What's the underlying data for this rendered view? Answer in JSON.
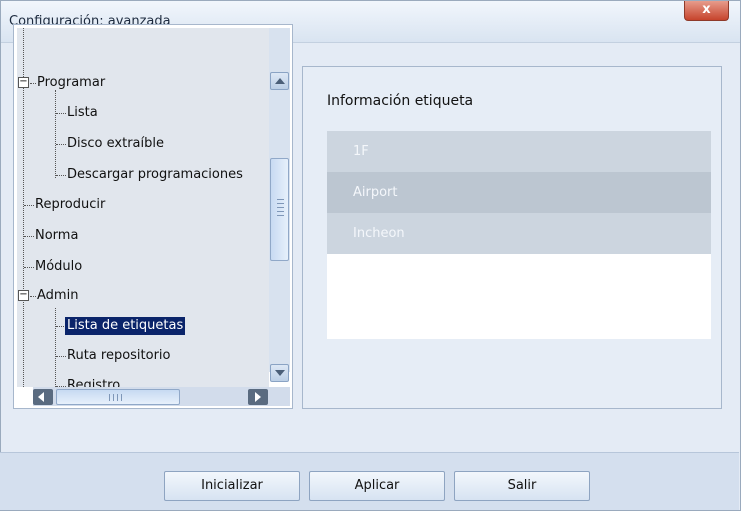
{
  "window": {
    "title": "Configuración: avanzada",
    "close_label": "x"
  },
  "tree": {
    "nodes": [
      {
        "label": "Programar",
        "expanded": true
      },
      {
        "label": "Lista"
      },
      {
        "label": "Disco extraíble"
      },
      {
        "label": "Descargar programaciones"
      },
      {
        "label": "Reproducir"
      },
      {
        "label": "Norma"
      },
      {
        "label": "Módulo"
      },
      {
        "label": "Admin",
        "expanded": true
      },
      {
        "label": "Lista de etiquetas",
        "selected": true
      },
      {
        "label": "Ruta repositorio"
      },
      {
        "label": "Registro"
      }
    ]
  },
  "panel": {
    "title": "Información etiqueta",
    "tags": [
      "1F",
      "Airport",
      "Incheon"
    ]
  },
  "buttons": {
    "initialize": "Inicializar",
    "apply": "Aplicar",
    "exit": "Salir"
  },
  "colors": {
    "selection": "#0a246a",
    "tag_row_a": "#ccd5df",
    "tag_row_b": "#bcc6d1"
  }
}
